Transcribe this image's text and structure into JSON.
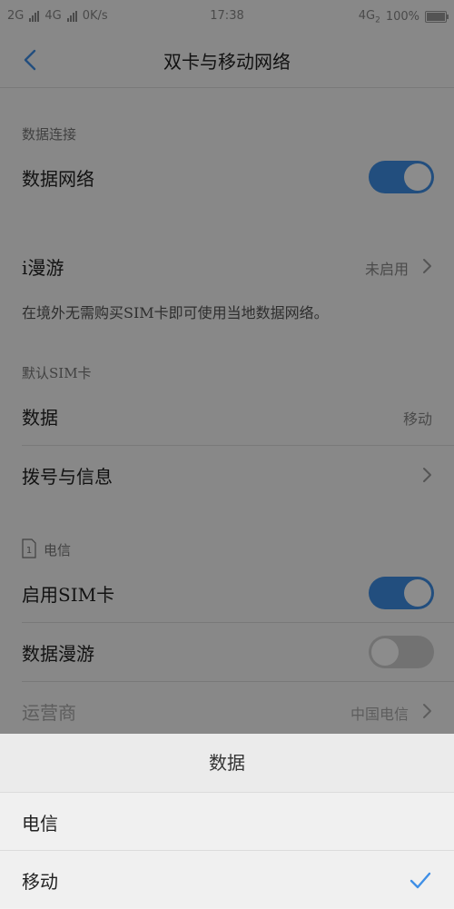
{
  "status_bar": {
    "sim1": "2G",
    "sim2": "4G",
    "speed": "0K/s",
    "time": "17:38",
    "network": "4G",
    "network_sub": "2",
    "battery": "100%",
    "battery_level": 1.0
  },
  "header": {
    "title": "双卡与移动网络",
    "back_icon": "chevron-left-icon"
  },
  "sections": {
    "data_connection": {
      "label": "数据连接",
      "data_network": {
        "label": "数据网络",
        "enabled": true
      }
    },
    "roaming": {
      "label": "i漫游",
      "value": "未启用",
      "hint": "在境外无需购买SIM卡即可使用当地数据网络。"
    },
    "default_sim": {
      "label": "默认SIM卡",
      "data": {
        "label": "数据",
        "value": "移动"
      },
      "dial": {
        "label": "拨号与信息"
      }
    },
    "sim1": {
      "label": "电信",
      "sim_number": "1",
      "enable_sim": {
        "label": "启用SIM卡",
        "enabled": true
      },
      "data_roaming": {
        "label": "数据漫游",
        "enabled": false
      },
      "carrier": {
        "label": "运营商",
        "value": "中国电信"
      }
    }
  },
  "sheet": {
    "title": "数据",
    "options": [
      {
        "label": "电信",
        "selected": false
      },
      {
        "label": "移动",
        "selected": true
      }
    ]
  },
  "colors": {
    "accent": "#3f8fe6",
    "toggle_off": "#cfcfcf",
    "overlay": "rgba(0,0,0,0.45)"
  }
}
